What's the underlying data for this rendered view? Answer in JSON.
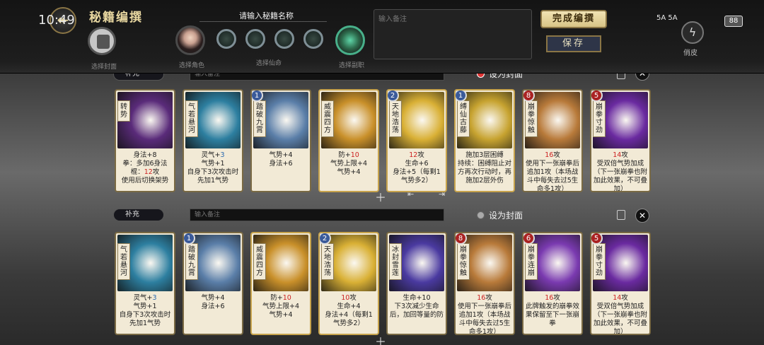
{
  "status": {
    "time": "10:49",
    "signal": "5A 5A",
    "battery": "88"
  },
  "header": {
    "title": "秘籍编撰",
    "name_prompt": "请输入秘籍名称",
    "note_placeholder": "输入备注",
    "done_label": "完成编撰",
    "save_label": "保存",
    "glyph_label": "俏皮"
  },
  "slots": {
    "cover_label": "选择封面",
    "role_label": "选择角色",
    "life_label": "选择仙命",
    "deck_label": "选择副职"
  },
  "rows": [
    {
      "supplement": "补充",
      "note_placeholder": "输入备注",
      "set_cover": "设为封面",
      "cover_selected": true,
      "cards": [
        {
          "name": "转势",
          "cost": "",
          "text": [
            [
              "身法+8",
              ""
            ],
            [
              "拳：多加6身法",
              ""
            ],
            [
              "棍：",
              "12",
              "攻"
            ],
            [
              "使用后切换架势",
              ""
            ]
          ],
          "art": "#5a2b7a"
        },
        {
          "name": "气若悬河",
          "cost": "",
          "text": [
            [
              "灵气+",
              "3",
              ""
            ],
            [
              "气势+1",
              ""
            ],
            [
              "自身下3次攻击时先加1气势",
              ""
            ]
          ],
          "art": "#2d7fa0"
        },
        {
          "name": "踏破九霄",
          "cost": "1",
          "text": [
            [
              "气势+4",
              ""
            ],
            [
              "身法+6",
              ""
            ]
          ],
          "art": "#5a7ea8"
        },
        {
          "name": "威震四方",
          "cost": "",
          "text": [
            [
              "防+",
              "10",
              ""
            ],
            [
              "气势上限+4",
              ""
            ],
            [
              "气势+4",
              ""
            ]
          ],
          "art": "#c9902a"
        },
        {
          "name": "天地浩荡",
          "cost": "2",
          "text": [
            [
              "",
              "12",
              "攻"
            ],
            [
              "生命+6",
              ""
            ],
            [
              "身法+5（每剩1气势多2）",
              ""
            ]
          ],
          "art": "#d9b035"
        },
        {
          "name": "缚仙古藤",
          "cost": "1",
          "text": [
            [
              "施加3层困缚",
              ""
            ],
            [
              "持续：困缚阻止对方再次行动时，再施加2层外伤",
              ""
            ]
          ],
          "art": "#c7a330"
        },
        {
          "name": "崩拳·惊触",
          "cost": "8",
          "text": [
            [
              "",
              "16",
              "攻"
            ],
            [
              "使用下一张崩拳后追加1攻（本场战斗中每失去过5生命多1攻）",
              ""
            ]
          ],
          "art": "#b87a3a"
        },
        {
          "name": "崩拳·寸劲",
          "cost": "5",
          "text": [
            [
              "",
              "14",
              "攻"
            ],
            [
              "受双倍气势加成（下一张崩拳也附加此效果，不可叠加）",
              ""
            ]
          ],
          "art": "#6a2aa0"
        }
      ]
    },
    {
      "supplement": "补充",
      "note_placeholder": "输入备注",
      "set_cover": "设为封面",
      "cover_selected": false,
      "cards": [
        {
          "name": "气若悬河",
          "cost": "",
          "text": [
            [
              "灵气+",
              "3",
              ""
            ],
            [
              "气势+1",
              ""
            ],
            [
              "自身下3次攻击时先加1气势",
              ""
            ]
          ],
          "art": "#2d7fa0"
        },
        {
          "name": "踏破九霄",
          "cost": "1",
          "text": [
            [
              "气势+4",
              ""
            ],
            [
              "身法+6",
              ""
            ]
          ],
          "art": "#5a7ea8"
        },
        {
          "name": "威震四方",
          "cost": "",
          "text": [
            [
              "防+",
              "10",
              ""
            ],
            [
              "气势上限+4",
              ""
            ],
            [
              "气势+4",
              ""
            ]
          ],
          "art": "#c9902a"
        },
        {
          "name": "天地浩荡",
          "cost": "2",
          "text": [
            [
              "",
              "10",
              "攻"
            ],
            [
              "生命+4",
              ""
            ],
            [
              "身法+4（每剩1气势多2）",
              ""
            ]
          ],
          "art": "#d9b035"
        },
        {
          "name": "冰封雪莲",
          "cost": "",
          "text": [
            [
              "生命+10",
              ""
            ],
            [
              "下3次减少生命后，加回等量的防",
              ""
            ]
          ],
          "art": "#4a3aa0"
        },
        {
          "name": "崩拳·惊触",
          "cost": "8",
          "text": [
            [
              "",
              "16",
              "攻"
            ],
            [
              "使用下一张崩拳后追加1攻（本场战斗中每失去过5生命多1攻）",
              ""
            ]
          ],
          "art": "#b87a3a"
        },
        {
          "name": "崩拳·连崩",
          "cost": "6",
          "text": [
            [
              "",
              "16",
              "攻"
            ],
            [
              "此牌触发的崩拳效果保留至下一张崩拳",
              ""
            ]
          ],
          "art": "#7a3ab0"
        },
        {
          "name": "崩拳·寸劲",
          "cost": "5",
          "text": [
            [
              "",
              "14",
              "攻"
            ],
            [
              "受双倍气势加成（下一张崩拳也附加此效果，不可叠加）",
              ""
            ]
          ],
          "art": "#6a2aa0"
        }
      ]
    }
  ]
}
